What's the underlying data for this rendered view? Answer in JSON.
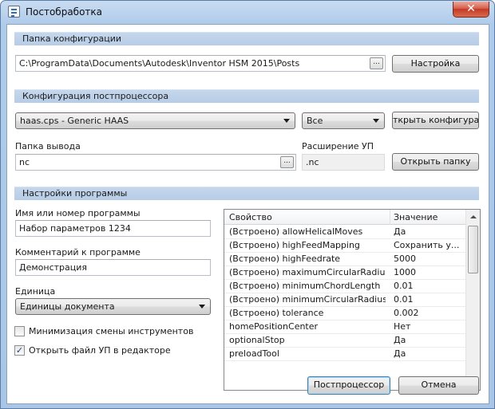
{
  "window": {
    "title": "Постобработка",
    "close_glyph": "✕"
  },
  "config_folder": {
    "header": "Папка конфигурации",
    "path": "C:\\ProgramData\\Documents\\Autodesk\\Inventor HSM 2015\\Posts",
    "browse_label": "...",
    "setup_button": "Настройка"
  },
  "post_config": {
    "header": "Конфигурация постпроцессора",
    "selected": "haas.cps - Generic HAAS",
    "filter": "Все",
    "open_config_button": "ткрыть конфигураци"
  },
  "output": {
    "folder_label": "Папка вывода",
    "folder_value": "nc",
    "browse_label": "...",
    "ext_label": "Расширение УП",
    "ext_value": ".nc",
    "open_folder_button": "Открыть папку"
  },
  "program": {
    "header": "Настройки программы",
    "name_label": "Имя или номер программы",
    "name_value": "Набор параметров 1234",
    "comment_label": "Комментарий к программе",
    "comment_value": "Демонстрация",
    "unit_label": "Единица",
    "unit_value": "Единицы документа",
    "minimize_tool_changes": "Минимизация смены инструментов",
    "minimize_checked": false,
    "open_in_editor": "Открыть файл УП в редакторе",
    "open_checked": true,
    "check_glyph": "✓"
  },
  "properties": {
    "col_property": "Свойство",
    "col_value": "Значение",
    "rows": [
      {
        "name": "(Встроено) allowHelicalMoves",
        "value": "Да"
      },
      {
        "name": "(Встроено) highFeedMapping",
        "value": "Сохранить у..."
      },
      {
        "name": "(Встроено) highFeedrate",
        "value": "5000"
      },
      {
        "name": "(Встроено) maximumCircularRadius",
        "value": "1000"
      },
      {
        "name": "(Встроено) minimumChordLength",
        "value": "0.01"
      },
      {
        "name": "(Встроено) minimumCircularRadius",
        "value": "0.01"
      },
      {
        "name": "(Встроено) tolerance",
        "value": "0.002"
      },
      {
        "name": "homePositionCenter",
        "value": "Нет"
      },
      {
        "name": "optionalStop",
        "value": "Да"
      },
      {
        "name": "preloadTool",
        "value": "Да"
      }
    ]
  },
  "buttons": {
    "post": "Постпроцессор",
    "cancel": "Отмена"
  }
}
